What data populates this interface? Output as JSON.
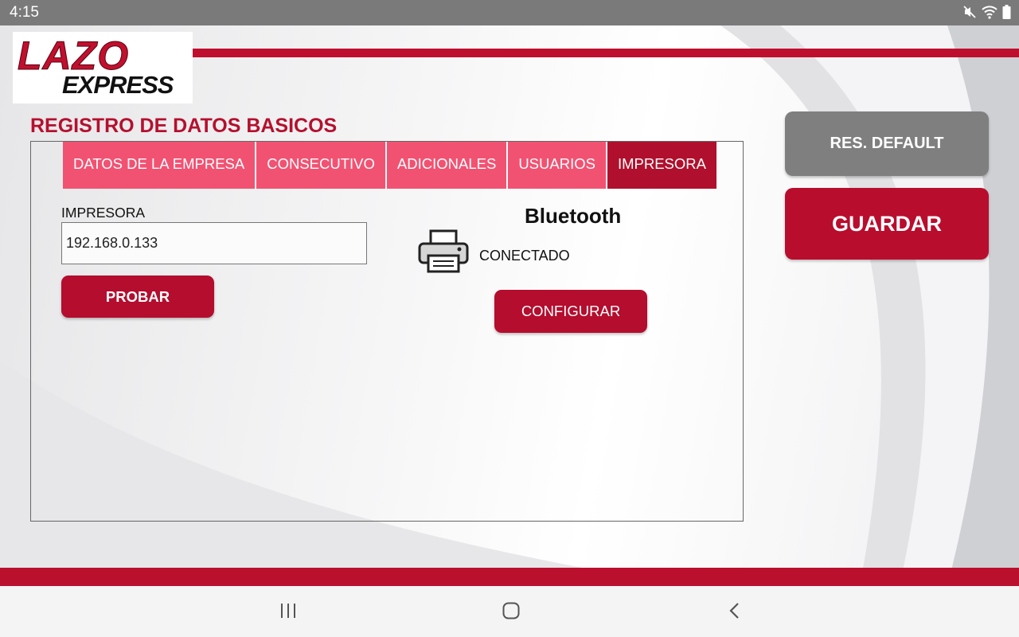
{
  "status_bar": {
    "time": "4:15"
  },
  "logo": {
    "line1": "LAZO",
    "line2": "EXPRESS"
  },
  "page": {
    "title": "REGISTRO DE DATOS BASICOS"
  },
  "tabs": [
    {
      "label": "DATOS DE LA EMPRESA",
      "active": false
    },
    {
      "label": "CONSECUTIVO",
      "active": false
    },
    {
      "label": "ADICIONALES",
      "active": false
    },
    {
      "label": "USUARIOS",
      "active": false
    },
    {
      "label": "IMPRESORA",
      "active": true
    }
  ],
  "printer": {
    "field_label": "IMPRESORA",
    "ip_value": "192.168.0.133",
    "test_button": "PROBAR",
    "bluetooth_title": "Bluetooth",
    "status": "CONECTADO",
    "configure_button": "CONFIGURAR"
  },
  "actions": {
    "reset_default": "RES. DEFAULT",
    "save": "GUARDAR"
  },
  "colors": {
    "brand_red": "#bf0f2e",
    "tab_inactive": "#f25272",
    "tab_active": "#b0102d",
    "button_gray": "#7f7f7f"
  },
  "icons": [
    "mute-icon",
    "wifi-icon",
    "battery-icon",
    "printer-icon",
    "recent-apps-icon",
    "home-icon",
    "back-icon"
  ]
}
